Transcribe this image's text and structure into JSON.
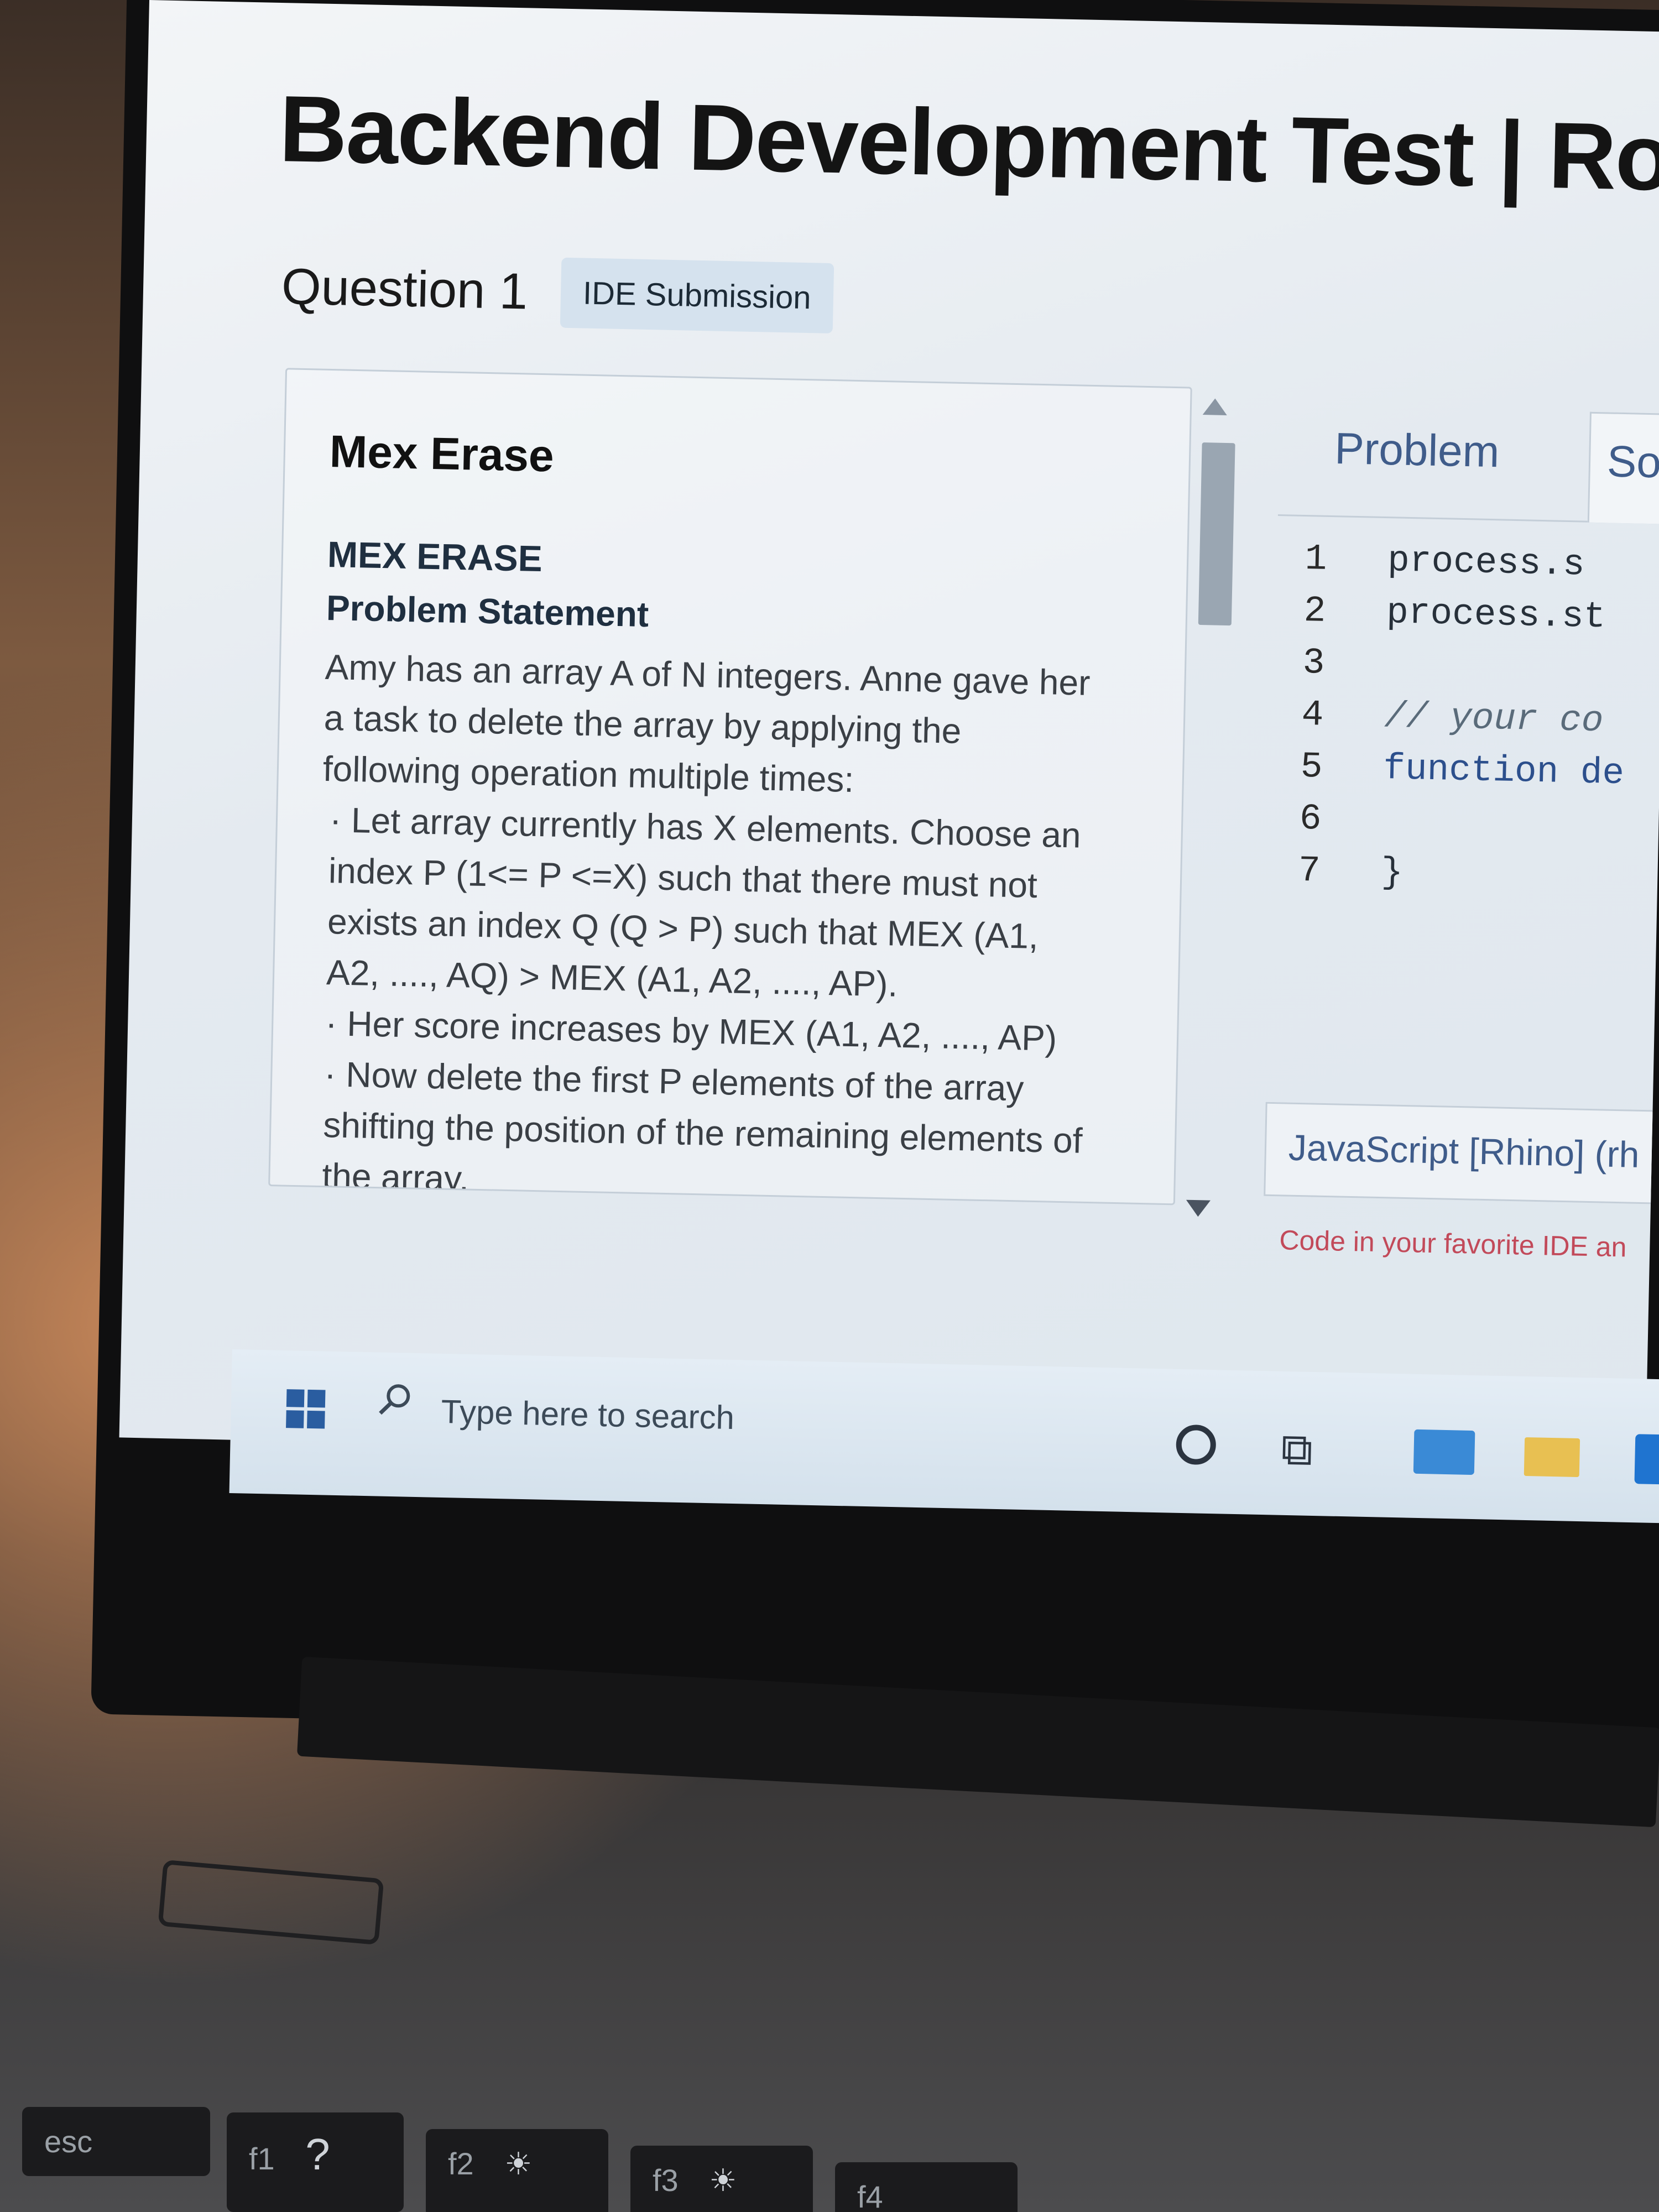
{
  "header": {
    "title": "Backend Development Test | Roun",
    "question_label": "Question 1",
    "question_badge": "IDE Submission"
  },
  "problem_panel": {
    "title": "Mex Erase",
    "heading": "MEX ERASE",
    "subheading": "Problem Statement",
    "paragraph": "Amy has an array A of N integers. Anne gave her a task to delete the array by applying the following operation multiple times:",
    "bullets": [
      "· Let array currently has X elements. Choose an index P (1<= P <=X) such that there must not exists an index Q (Q > P) such that MEX (A1, A2, ...., AQ) > MEX (A1, A2, ...., AP).",
      "· Her score increases by MEX (A1, A2, ...., AP)",
      "· Now delete the first P elements of the array shifting the position of the remaining elements of the array."
    ]
  },
  "editor": {
    "tabs": [
      {
        "label": "Problem"
      },
      {
        "label": "Solv"
      }
    ],
    "lines": [
      {
        "num": "1",
        "text": "process.s"
      },
      {
        "num": "2",
        "text": "process.st"
      },
      {
        "num": "3",
        "text": ""
      },
      {
        "num": "4",
        "text": "// your co"
      },
      {
        "num": "5",
        "text": "function de"
      },
      {
        "num": "6",
        "text": ""
      },
      {
        "num": "7",
        "text": "}"
      }
    ],
    "language": "JavaScript [Rhino] (rh",
    "ide_note": "Code in your favorite IDE an"
  },
  "taskbar": {
    "search_placeholder": "Type here to search"
  },
  "keyboard": {
    "keys": [
      "esc",
      "f1",
      "?",
      "f2",
      "f3",
      "f4"
    ]
  },
  "colors": {
    "accent": "#3f5c8a",
    "badge_bg": "#d5e2ee",
    "note_red": "#c24a5a"
  }
}
